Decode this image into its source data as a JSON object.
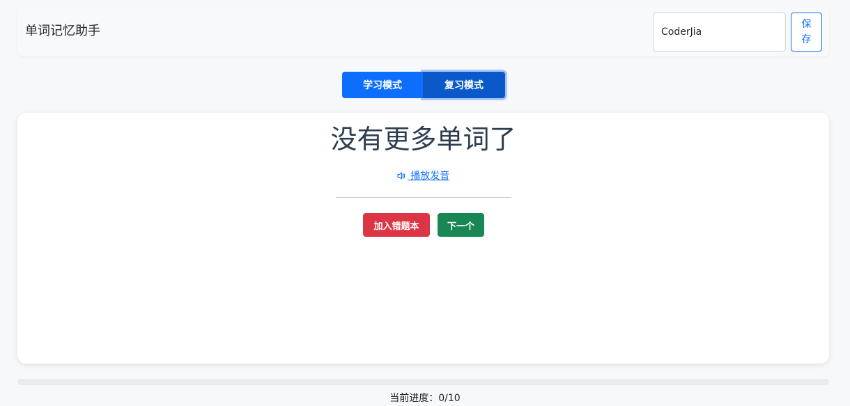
{
  "header": {
    "title": "单词记忆助手",
    "username_value": "CoderJia",
    "save_label": "保存"
  },
  "modes": {
    "learn_label": "学习模式",
    "review_label": "复习模式",
    "active": "review"
  },
  "card": {
    "word": "没有更多单词了",
    "play_label": " 播放发音",
    "play_icon": "speaker-icon",
    "add_wrong_label": "加入错题本",
    "next_label": "下一个"
  },
  "progress": {
    "label": "当前进度：",
    "current": 0,
    "total": 10,
    "display": "0/10",
    "fraction": 0
  },
  "colors": {
    "primary": "#0d6efd",
    "primary_active": "#0a58ca",
    "danger": "#dc3545",
    "success": "#198754"
  }
}
